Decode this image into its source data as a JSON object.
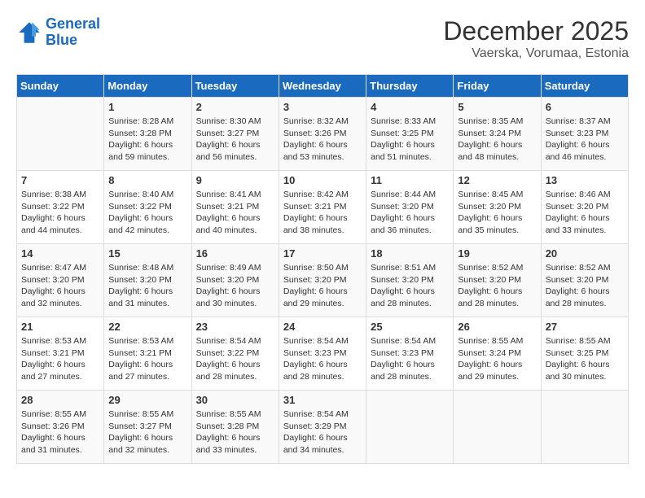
{
  "header": {
    "logo_line1": "General",
    "logo_line2": "Blue",
    "month": "December 2025",
    "location": "Vaerska, Vorumaa, Estonia"
  },
  "weekdays": [
    "Sunday",
    "Monday",
    "Tuesday",
    "Wednesday",
    "Thursday",
    "Friday",
    "Saturday"
  ],
  "weeks": [
    [
      {
        "day": null
      },
      {
        "day": "1",
        "sunrise": "Sunrise: 8:28 AM",
        "sunset": "Sunset: 3:28 PM",
        "daylight": "Daylight: 6 hours and 59 minutes."
      },
      {
        "day": "2",
        "sunrise": "Sunrise: 8:30 AM",
        "sunset": "Sunset: 3:27 PM",
        "daylight": "Daylight: 6 hours and 56 minutes."
      },
      {
        "day": "3",
        "sunrise": "Sunrise: 8:32 AM",
        "sunset": "Sunset: 3:26 PM",
        "daylight": "Daylight: 6 hours and 53 minutes."
      },
      {
        "day": "4",
        "sunrise": "Sunrise: 8:33 AM",
        "sunset": "Sunset: 3:25 PM",
        "daylight": "Daylight: 6 hours and 51 minutes."
      },
      {
        "day": "5",
        "sunrise": "Sunrise: 8:35 AM",
        "sunset": "Sunset: 3:24 PM",
        "daylight": "Daylight: 6 hours and 48 minutes."
      },
      {
        "day": "6",
        "sunrise": "Sunrise: 8:37 AM",
        "sunset": "Sunset: 3:23 PM",
        "daylight": "Daylight: 6 hours and 46 minutes."
      }
    ],
    [
      {
        "day": "7",
        "sunrise": "Sunrise: 8:38 AM",
        "sunset": "Sunset: 3:22 PM",
        "daylight": "Daylight: 6 hours and 44 minutes."
      },
      {
        "day": "8",
        "sunrise": "Sunrise: 8:40 AM",
        "sunset": "Sunset: 3:22 PM",
        "daylight": "Daylight: 6 hours and 42 minutes."
      },
      {
        "day": "9",
        "sunrise": "Sunrise: 8:41 AM",
        "sunset": "Sunset: 3:21 PM",
        "daylight": "Daylight: 6 hours and 40 minutes."
      },
      {
        "day": "10",
        "sunrise": "Sunrise: 8:42 AM",
        "sunset": "Sunset: 3:21 PM",
        "daylight": "Daylight: 6 hours and 38 minutes."
      },
      {
        "day": "11",
        "sunrise": "Sunrise: 8:44 AM",
        "sunset": "Sunset: 3:20 PM",
        "daylight": "Daylight: 6 hours and 36 minutes."
      },
      {
        "day": "12",
        "sunrise": "Sunrise: 8:45 AM",
        "sunset": "Sunset: 3:20 PM",
        "daylight": "Daylight: 6 hours and 35 minutes."
      },
      {
        "day": "13",
        "sunrise": "Sunrise: 8:46 AM",
        "sunset": "Sunset: 3:20 PM",
        "daylight": "Daylight: 6 hours and 33 minutes."
      }
    ],
    [
      {
        "day": "14",
        "sunrise": "Sunrise: 8:47 AM",
        "sunset": "Sunset: 3:20 PM",
        "daylight": "Daylight: 6 hours and 32 minutes."
      },
      {
        "day": "15",
        "sunrise": "Sunrise: 8:48 AM",
        "sunset": "Sunset: 3:20 PM",
        "daylight": "Daylight: 6 hours and 31 minutes."
      },
      {
        "day": "16",
        "sunrise": "Sunrise: 8:49 AM",
        "sunset": "Sunset: 3:20 PM",
        "daylight": "Daylight: 6 hours and 30 minutes."
      },
      {
        "day": "17",
        "sunrise": "Sunrise: 8:50 AM",
        "sunset": "Sunset: 3:20 PM",
        "daylight": "Daylight: 6 hours and 29 minutes."
      },
      {
        "day": "18",
        "sunrise": "Sunrise: 8:51 AM",
        "sunset": "Sunset: 3:20 PM",
        "daylight": "Daylight: 6 hours and 28 minutes."
      },
      {
        "day": "19",
        "sunrise": "Sunrise: 8:52 AM",
        "sunset": "Sunset: 3:20 PM",
        "daylight": "Daylight: 6 hours and 28 minutes."
      },
      {
        "day": "20",
        "sunrise": "Sunrise: 8:52 AM",
        "sunset": "Sunset: 3:20 PM",
        "daylight": "Daylight: 6 hours and 28 minutes."
      }
    ],
    [
      {
        "day": "21",
        "sunrise": "Sunrise: 8:53 AM",
        "sunset": "Sunset: 3:21 PM",
        "daylight": "Daylight: 6 hours and 27 minutes."
      },
      {
        "day": "22",
        "sunrise": "Sunrise: 8:53 AM",
        "sunset": "Sunset: 3:21 PM",
        "daylight": "Daylight: 6 hours and 27 minutes."
      },
      {
        "day": "23",
        "sunrise": "Sunrise: 8:54 AM",
        "sunset": "Sunset: 3:22 PM",
        "daylight": "Daylight: 6 hours and 28 minutes."
      },
      {
        "day": "24",
        "sunrise": "Sunrise: 8:54 AM",
        "sunset": "Sunset: 3:23 PM",
        "daylight": "Daylight: 6 hours and 28 minutes."
      },
      {
        "day": "25",
        "sunrise": "Sunrise: 8:54 AM",
        "sunset": "Sunset: 3:23 PM",
        "daylight": "Daylight: 6 hours and 28 minutes."
      },
      {
        "day": "26",
        "sunrise": "Sunrise: 8:55 AM",
        "sunset": "Sunset: 3:24 PM",
        "daylight": "Daylight: 6 hours and 29 minutes."
      },
      {
        "day": "27",
        "sunrise": "Sunrise: 8:55 AM",
        "sunset": "Sunset: 3:25 PM",
        "daylight": "Daylight: 6 hours and 30 minutes."
      }
    ],
    [
      {
        "day": "28",
        "sunrise": "Sunrise: 8:55 AM",
        "sunset": "Sunset: 3:26 PM",
        "daylight": "Daylight: 6 hours and 31 minutes."
      },
      {
        "day": "29",
        "sunrise": "Sunrise: 8:55 AM",
        "sunset": "Sunset: 3:27 PM",
        "daylight": "Daylight: 6 hours and 32 minutes."
      },
      {
        "day": "30",
        "sunrise": "Sunrise: 8:55 AM",
        "sunset": "Sunset: 3:28 PM",
        "daylight": "Daylight: 6 hours and 33 minutes."
      },
      {
        "day": "31",
        "sunrise": "Sunrise: 8:54 AM",
        "sunset": "Sunset: 3:29 PM",
        "daylight": "Daylight: 6 hours and 34 minutes."
      },
      {
        "day": null
      },
      {
        "day": null
      },
      {
        "day": null
      }
    ]
  ]
}
